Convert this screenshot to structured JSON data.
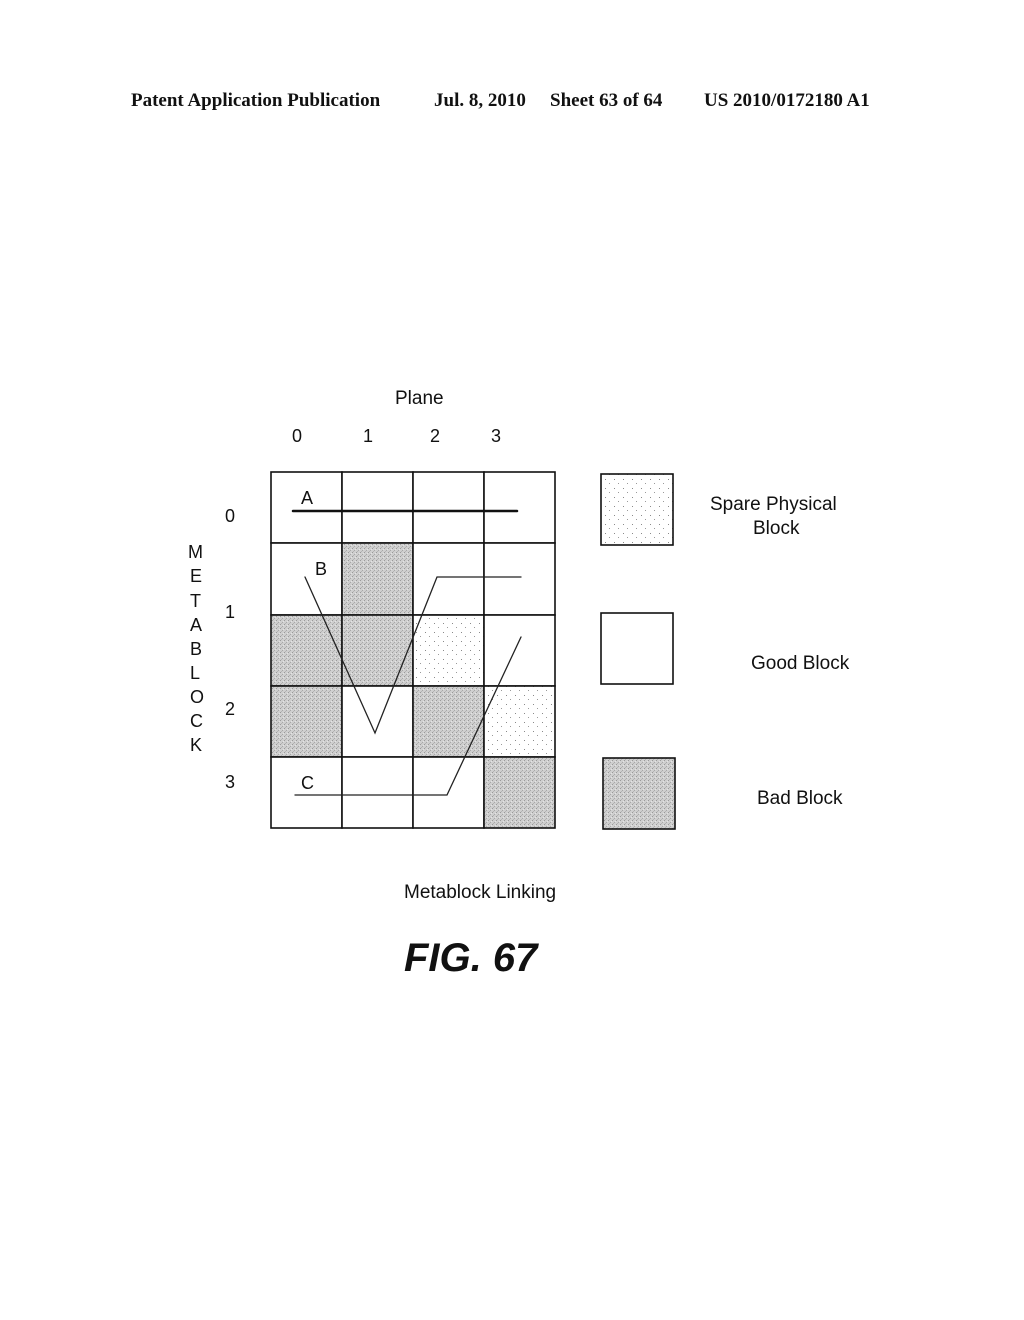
{
  "header": {
    "publication": "Patent Application Publication",
    "date": "Jul. 8, 2010",
    "sheet": "Sheet 63 of 64",
    "number": "US 2010/0172180 A1"
  },
  "diagram": {
    "plane_title": "Plane",
    "plane_labels": [
      "0",
      "1",
      "2",
      "3"
    ],
    "metablock_title_letters": [
      "M",
      "E",
      "T",
      "A",
      "B",
      "L",
      "O",
      "C",
      "K"
    ],
    "metablock_labels": [
      "0",
      "1",
      "2",
      "3"
    ],
    "grid_rows": [
      [
        "good",
        "good",
        "good",
        "good"
      ],
      [
        "good",
        "bad",
        "good",
        "good"
      ],
      [
        "bad",
        "bad",
        "spare",
        "good"
      ],
      [
        "bad",
        "good",
        "bad",
        "spare"
      ],
      [
        "good",
        "good",
        "good",
        "bad"
      ]
    ],
    "links": [
      {
        "label": "A",
        "description": "Metablock 0 linked across planes 0-3"
      },
      {
        "label": "B",
        "description": "Metablock B links plane 0 row 1, plane 1 row 3, spare in plane 2, plane 3"
      },
      {
        "label": "C",
        "description": "Metablock C links row 4 planes 0-2 to spare in plane 3"
      }
    ],
    "caption": "Metablock Linking",
    "figure_label": "FIG. 67"
  },
  "legend": [
    {
      "type": "spare",
      "label_lines": [
        "Spare Physical",
        "Block"
      ]
    },
    {
      "type": "good",
      "label_lines": [
        "Good Block"
      ]
    },
    {
      "type": "bad",
      "label_lines": [
        "Bad Block"
      ]
    }
  ],
  "colors": {
    "line": "#111111",
    "bad_fill": "#c8c8c8",
    "spare_dot": "#8a8a8a",
    "good_fill": "#ffffff"
  }
}
